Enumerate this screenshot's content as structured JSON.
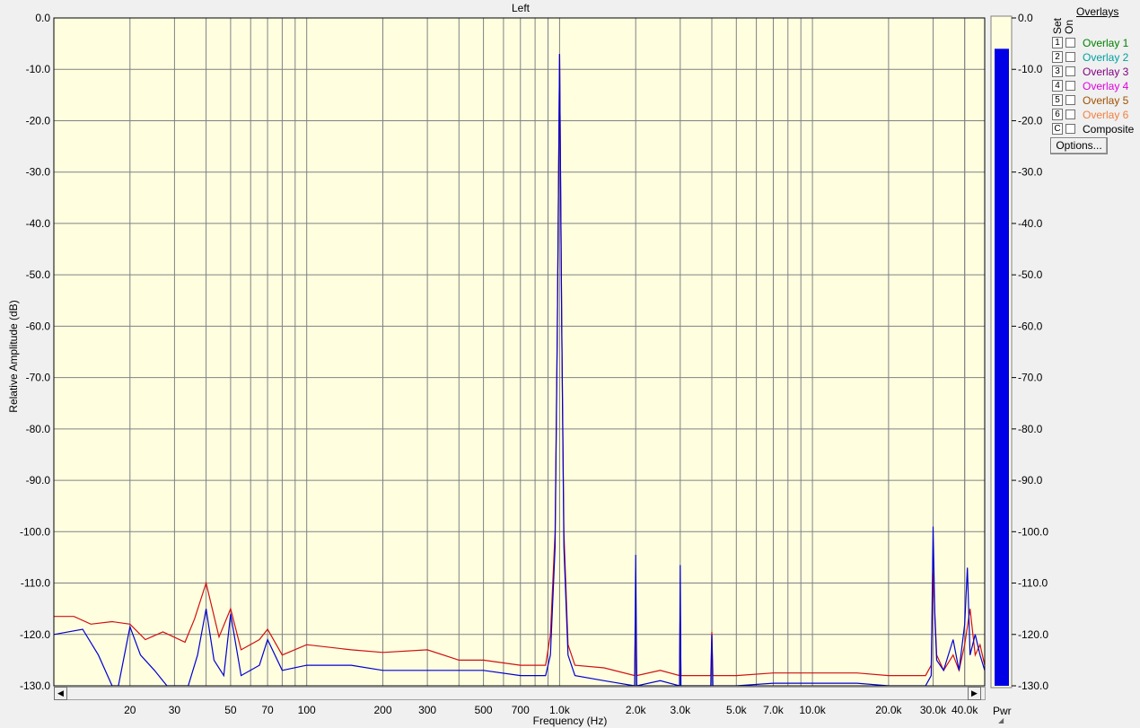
{
  "chart_data": {
    "type": "line",
    "title": "Left",
    "xlabel": "Frequency (Hz)",
    "ylabel": "Relative Amplitude (dB)",
    "x_scale": "log",
    "xlim": [
      10,
      48000
    ],
    "ylim": [
      -130,
      0
    ],
    "grid": true,
    "y_ticks": [
      "0.0",
      "-10.0",
      "-20.0",
      "-30.0",
      "-40.0",
      "-50.0",
      "-60.0",
      "-70.0",
      "-80.0",
      "-90.0",
      "-100.0",
      "-110.0",
      "-120.0",
      "-130.0"
    ],
    "y_tick_values": [
      0,
      -10,
      -20,
      -30,
      -40,
      -50,
      -60,
      -70,
      -80,
      -90,
      -100,
      -110,
      -120,
      -130
    ],
    "x_ticks": [
      {
        "v": 20,
        "label": "20"
      },
      {
        "v": 30,
        "label": "30"
      },
      {
        "v": 50,
        "label": "50"
      },
      {
        "v": 70,
        "label": "70"
      },
      {
        "v": 100,
        "label": "100"
      },
      {
        "v": 200,
        "label": "200"
      },
      {
        "v": 300,
        "label": "300"
      },
      {
        "v": 500,
        "label": "500"
      },
      {
        "v": 700,
        "label": "700"
      },
      {
        "v": 1000,
        "label": "1.0k"
      },
      {
        "v": 2000,
        "label": "2.0k"
      },
      {
        "v": 3000,
        "label": "3.0k"
      },
      {
        "v": 5000,
        "label": "5.0k"
      },
      {
        "v": 7000,
        "label": "7.0k"
      },
      {
        "v": 10000,
        "label": "10.0k"
      },
      {
        "v": 20000,
        "label": "20.0k"
      },
      {
        "v": 30000,
        "label": "30.0k"
      },
      {
        "v": 40000,
        "label": "40.0k"
      }
    ],
    "series": [
      {
        "color": "#d01010",
        "points": [
          [
            10,
            -116.5
          ],
          [
            12,
            -116.5
          ],
          [
            14,
            -118
          ],
          [
            17,
            -117.5
          ],
          [
            20,
            -118
          ],
          [
            23,
            -121
          ],
          [
            27,
            -119.5
          ],
          [
            33,
            -121.5
          ],
          [
            36,
            -117
          ],
          [
            40,
            -110
          ],
          [
            45,
            -120.5
          ],
          [
            50,
            -115
          ],
          [
            55,
            -123
          ],
          [
            65,
            -121
          ],
          [
            70,
            -119
          ],
          [
            80,
            -124
          ],
          [
            100,
            -122
          ],
          [
            150,
            -123
          ],
          [
            200,
            -123.5
          ],
          [
            300,
            -123
          ],
          [
            400,
            -125
          ],
          [
            500,
            -125
          ],
          [
            700,
            -126
          ],
          [
            880,
            -126
          ],
          [
            920,
            -120
          ],
          [
            960,
            -100
          ],
          [
            980,
            -60
          ],
          [
            1000,
            -7
          ],
          [
            1020,
            -60
          ],
          [
            1040,
            -100
          ],
          [
            1080,
            -122
          ],
          [
            1150,
            -126
          ],
          [
            1500,
            -126.5
          ],
          [
            1980,
            -128
          ],
          [
            2000,
            -116
          ],
          [
            2020,
            -128
          ],
          [
            2500,
            -127
          ],
          [
            2980,
            -128
          ],
          [
            3000,
            -114
          ],
          [
            3020,
            -128
          ],
          [
            3960,
            -128
          ],
          [
            4000,
            -119.5
          ],
          [
            4040,
            -128
          ],
          [
            5000,
            -128
          ],
          [
            7000,
            -127.5
          ],
          [
            10000,
            -127.5
          ],
          [
            15000,
            -127.5
          ],
          [
            20000,
            -128
          ],
          [
            28000,
            -128
          ],
          [
            29500,
            -126
          ],
          [
            30000,
            -108
          ],
          [
            30500,
            -116
          ],
          [
            31000,
            -124
          ],
          [
            33000,
            -127
          ],
          [
            36000,
            -124
          ],
          [
            38000,
            -127
          ],
          [
            40000,
            -122
          ],
          [
            42000,
            -115
          ],
          [
            44000,
            -124
          ],
          [
            46000,
            -122
          ],
          [
            48000,
            -126
          ]
        ]
      },
      {
        "color": "#0000d0",
        "points": [
          [
            10,
            -120
          ],
          [
            13,
            -119
          ],
          [
            15,
            -124
          ],
          [
            17,
            -130
          ],
          [
            18,
            -130
          ],
          [
            20,
            -118.5
          ],
          [
            22,
            -124
          ],
          [
            25,
            -127
          ],
          [
            28,
            -130
          ],
          [
            34,
            -130
          ],
          [
            37,
            -124
          ],
          [
            40,
            -115
          ],
          [
            43,
            -125
          ],
          [
            47,
            -128
          ],
          [
            50,
            -116
          ],
          [
            55,
            -128
          ],
          [
            65,
            -126
          ],
          [
            70,
            -121
          ],
          [
            80,
            -127
          ],
          [
            100,
            -126
          ],
          [
            150,
            -126
          ],
          [
            200,
            -127
          ],
          [
            300,
            -127
          ],
          [
            500,
            -127
          ],
          [
            700,
            -128
          ],
          [
            880,
            -128
          ],
          [
            920,
            -124
          ],
          [
            960,
            -103
          ],
          [
            980,
            -60
          ],
          [
            1000,
            -7
          ],
          [
            1020,
            -60
          ],
          [
            1040,
            -103
          ],
          [
            1080,
            -124
          ],
          [
            1150,
            -128
          ],
          [
            1500,
            -129
          ],
          [
            1980,
            -130
          ],
          [
            2000,
            -104.5
          ],
          [
            2020,
            -130
          ],
          [
            2500,
            -129
          ],
          [
            2980,
            -130
          ],
          [
            3000,
            -106.5
          ],
          [
            3020,
            -130
          ],
          [
            3960,
            -130
          ],
          [
            4000,
            -120
          ],
          [
            4040,
            -130
          ],
          [
            5000,
            -130
          ],
          [
            7000,
            -129.5
          ],
          [
            10000,
            -129.5
          ],
          [
            15000,
            -129.5
          ],
          [
            20000,
            -130
          ],
          [
            28000,
            -130
          ],
          [
            29500,
            -128
          ],
          [
            30000,
            -99
          ],
          [
            30500,
            -117
          ],
          [
            31000,
            -125
          ],
          [
            33000,
            -127
          ],
          [
            36000,
            -121
          ],
          [
            38000,
            -127
          ],
          [
            40000,
            -118
          ],
          [
            41000,
            -107
          ],
          [
            42000,
            -124
          ],
          [
            44000,
            -120
          ],
          [
            46000,
            -124
          ],
          [
            48000,
            -127
          ]
        ]
      }
    ]
  },
  "meter": {
    "label": "Pwr",
    "value_db": -6,
    "color": "#0000e6",
    "ticks": [
      "0.0",
      "-10.0",
      "-20.0",
      "-30.0",
      "-40.0",
      "-50.0",
      "-60.0",
      "-70.0",
      "-80.0",
      "-90.0",
      "-100.0",
      "-110.0",
      "-120.0",
      "-130.0"
    ]
  },
  "overlays": {
    "title": "Overlays",
    "set_label": "Set",
    "on_label": "On",
    "items": [
      {
        "num": "1",
        "label": "Overlay 1",
        "color": "#008000"
      },
      {
        "num": "2",
        "label": "Overlay 2",
        "color": "#00a0a0"
      },
      {
        "num": "3",
        "label": "Overlay 3",
        "color": "#800080"
      },
      {
        "num": "4",
        "label": "Overlay 4",
        "color": "#e000e0"
      },
      {
        "num": "5",
        "label": "Overlay 5",
        "color": "#a05000"
      },
      {
        "num": "6",
        "label": "Overlay 6",
        "color": "#f08040"
      },
      {
        "num": "C",
        "label": "Composite",
        "color": "#000000"
      }
    ],
    "options_label": "Options..."
  },
  "colors": {
    "plot_bg": "#ffffe0",
    "grid": "#808080",
    "meter_bg": "#ffffe0"
  }
}
